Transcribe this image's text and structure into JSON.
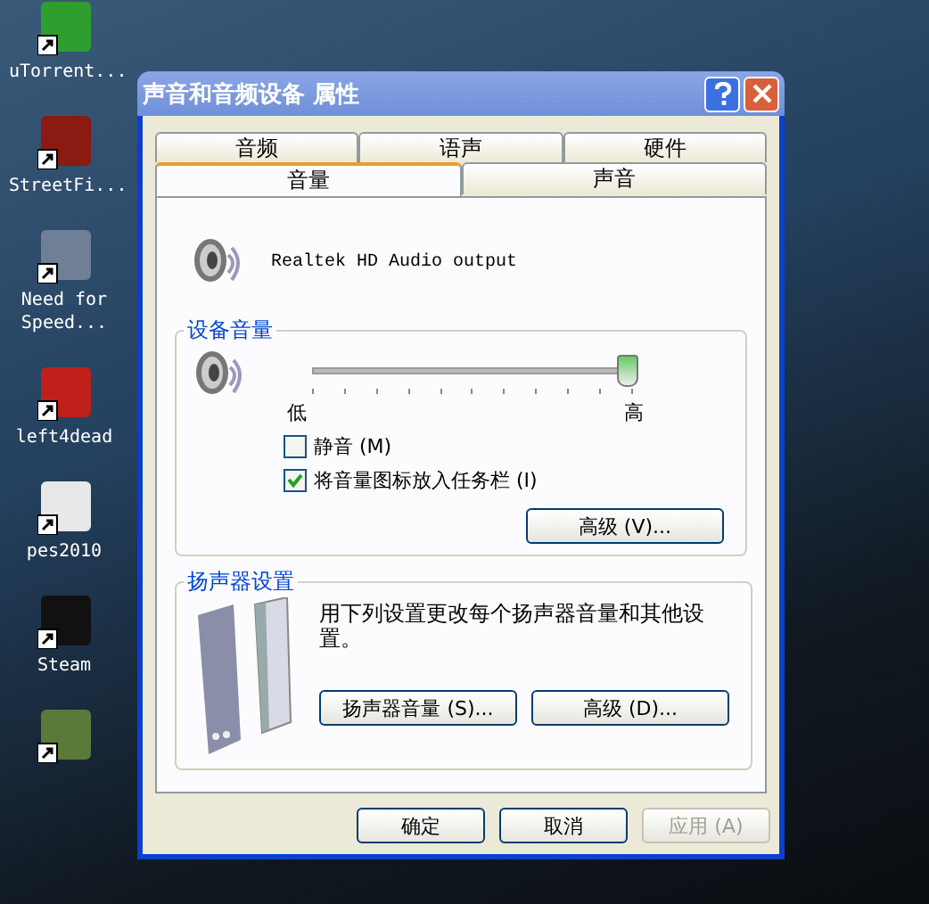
{
  "desktop": {
    "icons": [
      {
        "label": "uTorrent...",
        "color": "#2e9e2e"
      },
      {
        "label": "StreetFi...",
        "color": "#8a1a12"
      },
      {
        "label": "Need for Speed...",
        "color": "#6f7f96"
      },
      {
        "label": "left4dead",
        "color": "#c0201a"
      },
      {
        "label": "pes2010",
        "color": "#e8e8e8"
      },
      {
        "label": "Steam",
        "color": "#111111"
      },
      {
        "color": "#5a7a3a"
      }
    ]
  },
  "dialog": {
    "title": "声音和音频设备 属性",
    "tab_rows": [
      [
        {
          "label": "音频",
          "selected": false
        },
        {
          "label": "语声",
          "selected": false
        },
        {
          "label": "硬件",
          "selected": false
        }
      ],
      [
        {
          "label": "音量",
          "selected": true
        },
        {
          "label": "声音",
          "selected": false
        }
      ]
    ],
    "device_name": "Realtek HD Audio output",
    "device_volume": {
      "title": "设备音量",
      "level": 1.0,
      "low_label": "低",
      "high_label": "高",
      "checkboxes": [
        {
          "label": "静音 (M)",
          "checked": false
        },
        {
          "label": "将音量图标放入任务栏 (I)",
          "checked": true
        }
      ],
      "advanced_button": "高级 (V)..."
    },
    "speaker_settings": {
      "title": "扬声器设置",
      "description": "用下列设置更改每个扬声器音量和其他设置。",
      "buttons": [
        "扬声器音量 (S)...",
        "高级 (D)..."
      ]
    },
    "footer_buttons": [
      {
        "label": "确定",
        "disabled": false
      },
      {
        "label": "取消",
        "disabled": false
      },
      {
        "label": "应用 (A)",
        "disabled": true
      }
    ]
  }
}
